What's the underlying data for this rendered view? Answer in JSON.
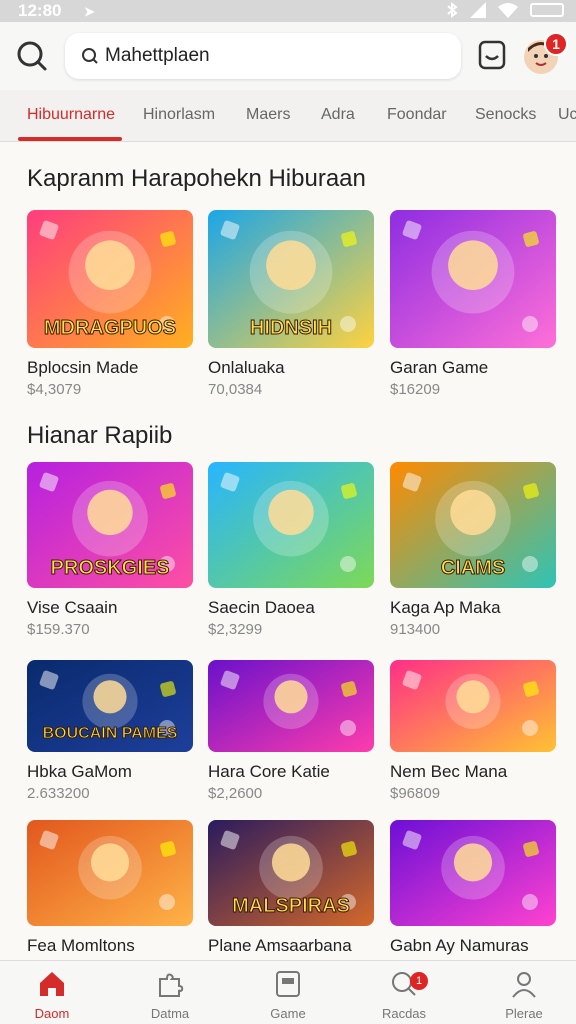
{
  "status_bar": {
    "time": "12:80"
  },
  "search": {
    "value": "Mahettplaen"
  },
  "notifications": {
    "count": "1"
  },
  "tabs": [
    {
      "label": "Hibuurnarne"
    },
    {
      "label": "Hinorlasm"
    },
    {
      "label": "Maers"
    },
    {
      "label": "Adra"
    },
    {
      "label": "Foondar"
    },
    {
      "label": "Senocks"
    },
    {
      "label": "Uc"
    }
  ],
  "sections": [
    {
      "title": "Kapranm Harapohekn Hiburaan"
    },
    {
      "title": "Hianar Rapiib"
    }
  ],
  "games": [
    {
      "name": "Bplocsin Made",
      "price": "$4,3079",
      "thumb_text": "MDRAGPUOS",
      "colors": [
        "#ff3d7f",
        "#ffb020"
      ]
    },
    {
      "name": "Onlaluaka",
      "price": "70,0384",
      "thumb_text": "HIDNSIH",
      "colors": [
        "#1ba6e8",
        "#ffd23f"
      ]
    },
    {
      "name": "Garan Game",
      "price": "$16209",
      "thumb_text": "",
      "colors": [
        "#8e2de2",
        "#ff6fd8"
      ]
    },
    {
      "name": "Vise Csaain",
      "price": "$159.370",
      "thumb_text": "PROSKGIES",
      "colors": [
        "#b620e0",
        "#ff4fa3"
      ]
    },
    {
      "name": "Saecin Daoea",
      "price": "$2,3299",
      "thumb_text": "",
      "colors": [
        "#27b5ff",
        "#7ed957"
      ]
    },
    {
      "name": "Kaga Ap Maka",
      "price": "913400",
      "thumb_text": "CIAMS",
      "colors": [
        "#ff8a00",
        "#2ec4b6"
      ]
    },
    {
      "name": "Hbka GaMom",
      "price": "2.633200",
      "thumb_text": "BOUCAIN PAMES",
      "colors": [
        "#0a2a6e",
        "#1d3f9a"
      ]
    },
    {
      "name": "Hara Core Katie",
      "price": "$2,2600",
      "thumb_text": "",
      "colors": [
        "#6a11cb",
        "#ff3cac"
      ]
    },
    {
      "name": "Nem Bec Mana",
      "price": "$96809",
      "thumb_text": "",
      "colors": [
        "#ff2e88",
        "#ffc233"
      ]
    },
    {
      "name": "Fea Momltons",
      "price": "",
      "thumb_text": "",
      "colors": [
        "#e2571d",
        "#ffb347"
      ]
    },
    {
      "name": "Plane Amsaarbana",
      "price": "",
      "thumb_text": "MALSPIRAS",
      "colors": [
        "#2a1b5e",
        "#d4682a"
      ]
    },
    {
      "name": "Gabn Ay Namuras",
      "price": "",
      "thumb_text": "",
      "colors": [
        "#6c0fd6",
        "#ff42d0"
      ]
    }
  ],
  "bottom_nav": [
    {
      "label": "Daom",
      "icon": "home-icon"
    },
    {
      "label": "Datma",
      "icon": "puzzle-icon"
    },
    {
      "label": "Game",
      "icon": "game-icon"
    },
    {
      "label": "Racdas",
      "icon": "search-icon",
      "badge": "1"
    },
    {
      "label": "Plerae",
      "icon": "profile-icon"
    }
  ],
  "accent_color": "#d42b2b"
}
